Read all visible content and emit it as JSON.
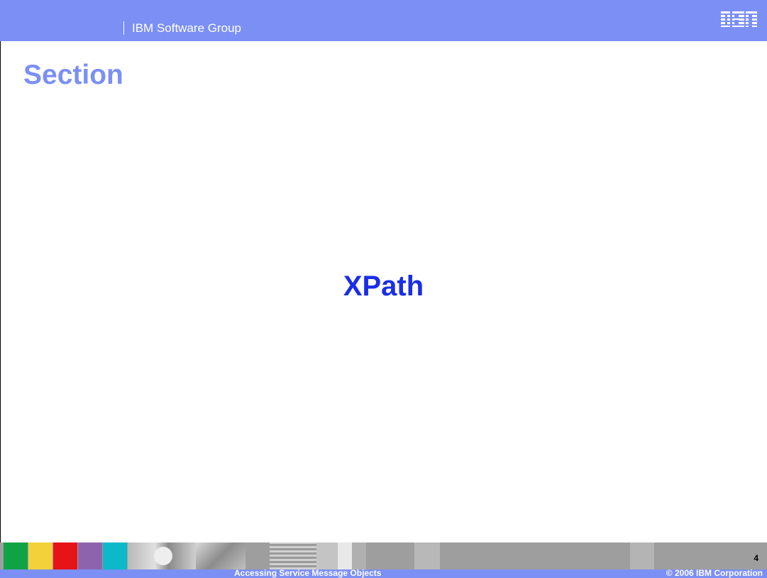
{
  "header": {
    "group": "IBM Software Group",
    "logo_text": "IBM"
  },
  "slide": {
    "section_label": "Section",
    "title": "XPath"
  },
  "footer": {
    "course_title": "Accessing Service Message Objects",
    "copyright": "© 2006 IBM Corporation",
    "page_number": "4"
  },
  "colors": {
    "header_bar": "#7b8ff5",
    "title": "#1a2ee6",
    "section_label": "#7b8ff5",
    "footer_strip": "#9e9e9e",
    "color_tiles": [
      "#10a346",
      "#f2d13b",
      "#e81316",
      "#8e63ae",
      "#0bb9c9"
    ]
  }
}
